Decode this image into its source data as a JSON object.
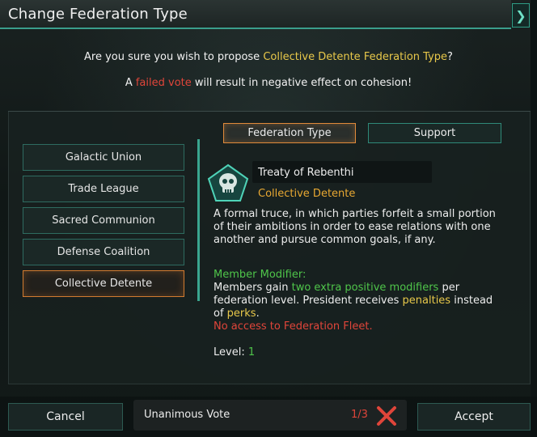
{
  "window": {
    "title": "Change Federation Type"
  },
  "confirm": {
    "q1_prefix": "Are you sure you wish to propose ",
    "q1_highlight": "Collective Detente Federation Type",
    "q1_suffix": "?",
    "q2_prefix": "A ",
    "q2_highlight": "failed vote",
    "q2_suffix": " will result in negative effect on cohesion!"
  },
  "tabs": [
    {
      "label": "Federation Type",
      "active": true
    },
    {
      "label": "Support",
      "active": false
    }
  ],
  "federation_types": [
    {
      "label": "Galactic Union"
    },
    {
      "label": "Trade League"
    },
    {
      "label": "Sacred Communion"
    },
    {
      "label": "Defense Coalition"
    },
    {
      "label": "Collective Detente",
      "selected": true
    }
  ],
  "detail": {
    "emblem_icon": "skull-icon",
    "treaty_name": "Treaty of Rebenthi",
    "type_name": "Collective Detente",
    "description": "A formal truce, in which parties forfeit a small portion of their ambitions in order to ease relations with one another and pursue common goals, if any.",
    "modifier_title": "Member Modifier:",
    "modifier_p1": "Members gain ",
    "modifier_h1": "two extra positive modifiers",
    "modifier_p2": " per federation level. President receives ",
    "modifier_h2": "penalties",
    "modifier_p3": " instead of ",
    "modifier_h3": "perks",
    "modifier_p4": ".",
    "no_access": "No access to Federation Fleet.",
    "level_label": "Level: ",
    "level_value": "1"
  },
  "footer": {
    "cancel_label": "Cancel",
    "accept_label": "Accept",
    "vote_label": "Unanimous Vote",
    "vote_count": "1/3",
    "vote_status_icon": "cross-icon"
  },
  "colors": {
    "highlight_gold": "#e8c84a",
    "warning_red": "#e0453a",
    "positive_green": "#4fc54a",
    "selection_orange": "#d27b30",
    "accent_teal": "#3a9e8c"
  }
}
